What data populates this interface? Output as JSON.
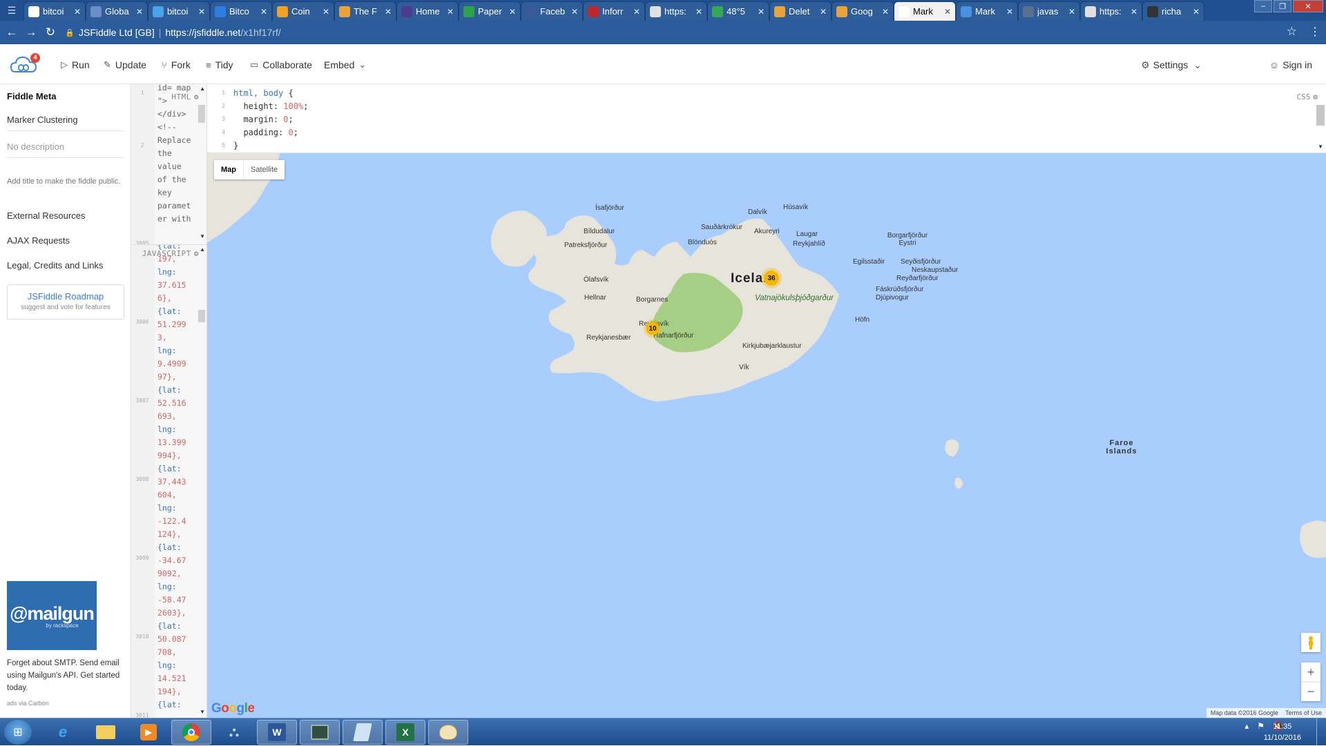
{
  "browser": {
    "tabs": [
      {
        "label": "bitcoi",
        "icon": "google-icon",
        "color": "#ffffff",
        "active": false
      },
      {
        "label": "Globa",
        "icon": "globe-icon",
        "color": "#6b8ec8",
        "active": false
      },
      {
        "label": "bitcoi",
        "icon": "bitcoin-icon",
        "color": "#4aa3e8",
        "active": false
      },
      {
        "label": "Bitco",
        "icon": "bitcoin-b-icon",
        "color": "#2f7de1",
        "active": false
      },
      {
        "label": "Coin",
        "icon": "coin-icon",
        "color": "#f4a020",
        "active": false
      },
      {
        "label": "The F",
        "icon": "f-icon",
        "color": "#e8a33a",
        "active": false
      },
      {
        "label": "Home",
        "icon": "ith-icon",
        "color": "#4c3b91",
        "active": false
      },
      {
        "label": "Paper",
        "icon": "paper-icon",
        "color": "#2ea34a",
        "active": false
      },
      {
        "label": "Faceb",
        "icon": "facebook-icon",
        "color": "#3b5998",
        "active": false
      },
      {
        "label": "Inforr",
        "icon": "info-icon",
        "color": "#c0272d",
        "active": false
      },
      {
        "label": "https:",
        "icon": "page-icon",
        "color": "#e0e0e0",
        "active": false
      },
      {
        "label": "48°5",
        "icon": "maps-icon",
        "color": "#34a853",
        "active": false
      },
      {
        "label": "Delet",
        "icon": "delete-icon",
        "color": "#e8a33a",
        "active": false
      },
      {
        "label": "Goog",
        "icon": "google-g-icon",
        "color": "#e8a33a",
        "active": false
      },
      {
        "label": "Mark",
        "icon": "marker-icon",
        "color": "#ffffff",
        "active": true
      },
      {
        "label": "Mark",
        "icon": "jsfiddle-icon",
        "color": "#4a90e2",
        "active": false
      },
      {
        "label": "javas",
        "icon": "js-icon",
        "color": "#5a6f8f",
        "active": false
      },
      {
        "label": "https:",
        "icon": "page-icon",
        "color": "#e0e0e0",
        "active": false
      },
      {
        "label": "richa",
        "icon": "github-icon",
        "color": "#333333",
        "active": false
      }
    ],
    "site_identity": "JSFiddle Ltd [GB]",
    "url_host": "https://jsfiddle.net",
    "url_path": "/x1hf17rf/"
  },
  "header": {
    "logo_badge": "4",
    "run": "Run",
    "update": "Update",
    "fork": "Fork",
    "tidy": "Tidy",
    "collaborate": "Collaborate",
    "embed": "Embed",
    "settings": "Settings",
    "sign_in": "Sign in"
  },
  "sidebar": {
    "title": "Fiddle Meta",
    "fiddle_title": "Marker Clustering",
    "description_placeholder": "No description",
    "help": "Add title to make the fiddle public.",
    "links": [
      "External Resources",
      "AJAX Requests",
      "Legal, Credits and Links"
    ],
    "roadmap_title": "JSFiddle Roadmap",
    "roadmap_sub": "suggest and vote for features",
    "ad_brand": "@mailgun",
    "ad_sub": "by rackspace",
    "ad_text": "Forget about SMTP. Send email using Mailgun's API. Get started today.",
    "ad_via": "ads via Carbon"
  },
  "html_pane": {
    "label": "HTML",
    "gutter": [
      "1",
      "2"
    ],
    "lines": [
      "id= map",
      "\">",
      "</div>",
      "<!--",
      "Replace",
      "the",
      "value",
      "of the",
      "key",
      "paramet",
      "er with"
    ]
  },
  "js_pane": {
    "label": "JAVASCRIPT",
    "gutter": [
      "3005",
      "3006",
      "3007",
      "3008",
      "3009",
      "3010",
      "3011"
    ],
    "lines": [
      "{lat:",
      "197,",
      "lng:",
      "37.615",
      "6},",
      "{lat:",
      "51.299",
      "3,",
      "lng:",
      "9.4909",
      "97},",
      "{lat:",
      "52.516",
      "693,",
      "lng:",
      "13.399",
      "994},",
      "{lat:",
      "37.443",
      "604,",
      "lng:",
      "-122.4",
      "124},",
      "{lat:",
      "-34.67",
      "9092,",
      "lng:",
      "-58.47",
      "2603},",
      "{lat:",
      "50.087",
      "708,",
      "lng:",
      "14.521",
      "194},",
      "{lat:"
    ]
  },
  "css_pane": {
    "label": "CSS",
    "gutter": [
      "1",
      "2",
      "3",
      "4",
      "5"
    ],
    "line1_sel": "html, body",
    "line2_prop": "height",
    "line2_val": "100%",
    "line3_prop": "margin",
    "line3_val": "0",
    "line4_prop": "padding",
    "line4_val": "0"
  },
  "map": {
    "type_map": "Map",
    "type_satellite": "Satellite",
    "country_label": "Icelan",
    "park_label": "Vatnajökulsþjóðgarður",
    "places": [
      "Ísafjörður",
      "Bíldudalur",
      "Patreksfjörður",
      "Ólafsvík",
      "Hellnar",
      "Borgarnes",
      "Reykjavík",
      "Hafnarfjörður",
      "Reykjanesbær",
      "Dalvík",
      "Húsavík",
      "Sauðárkrókur",
      "Akureyri",
      "Laugar",
      "Blönduós",
      "Reykjahlíð",
      "Borgarfjörður Eystri",
      "Egilsstaðir",
      "Seyðisfjörður",
      "Neskaupstaður",
      "Reyðarfjörður",
      "Fáskrúðsfjörður",
      "Djúpivogur",
      "Höfn",
      "Kirkjubæjarklaustur",
      "Vík"
    ],
    "faroe": "Faroe Islands",
    "clusters": [
      {
        "count": "36",
        "color": "#f2b705"
      },
      {
        "count": "10",
        "color": "#f2b705"
      }
    ],
    "google": "Google",
    "attribution": "Map data ©2016 Google",
    "terms": "Terms of Use",
    "zoom_in": "+",
    "zoom_out": "−",
    "land_color": "#e7e4dc",
    "sea_color": "#a9cdfd",
    "park_color": "#a6cf85"
  },
  "taskbar": {
    "apps": [
      "ie-icon",
      "explorer-icon",
      "media-player-icon",
      "chrome-icon",
      "network-icon",
      "word-icon",
      "terminal-icon",
      "notes-icon",
      "excel-icon",
      "paint-icon"
    ],
    "time": "11:35",
    "date": "11/10/2016"
  }
}
